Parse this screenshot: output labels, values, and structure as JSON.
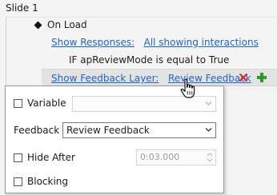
{
  "tree": {
    "slide_title": "Slide 1",
    "trigger": "On Load",
    "responses": {
      "label": "Show Responses:",
      "value": "All showing interactions"
    },
    "condition": "IF apReviewMode is equal to True",
    "action": {
      "label": "Show Feedback Layer:",
      "value": "Review Feedback"
    }
  },
  "popup": {
    "variable": {
      "label": "Variable",
      "checked": false,
      "value": ""
    },
    "feedback": {
      "label": "Feedback",
      "value": "Review Feedback"
    },
    "hide_after": {
      "label": "Hide After",
      "checked": false,
      "value": "0:03.000"
    },
    "blocking": {
      "label": "Blocking",
      "checked": false
    }
  },
  "icons": {
    "delete": "delete-x-icon",
    "add": "add-plus-icon",
    "cursor": "hand-pointer-icon"
  },
  "colors": {
    "link": "#2166c4",
    "delete": "#d9262b",
    "add": "#2e9a2e",
    "selected_row": "#e3e3e3"
  }
}
